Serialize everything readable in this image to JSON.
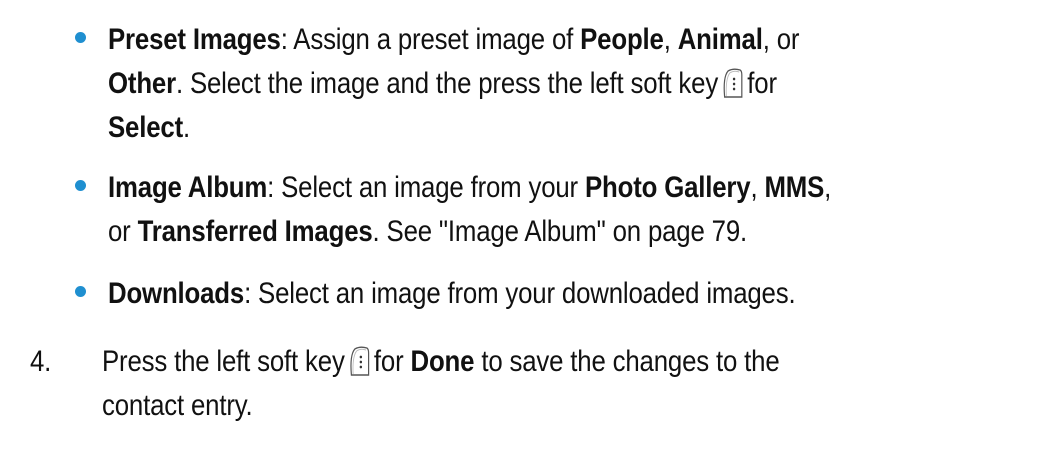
{
  "bullets": [
    {
      "line1": {
        "term": "Preset Images",
        "t1": ": Assign a preset image of ",
        "b1": "People",
        "t2": ", ",
        "b2": "Animal",
        "t3": ", or"
      },
      "line2": {
        "b1": "Other",
        "t1": ". Select the image and the press the left soft key",
        "t2": "for"
      },
      "line3": {
        "b1": "Select",
        "t1": "."
      }
    },
    {
      "line1": {
        "term": "Image Album",
        "t1": ": Select an image from your ",
        "b1": "Photo Gallery",
        "t2": ", ",
        "b2": "MMS",
        "t3": ","
      },
      "line2": {
        "t1": "or ",
        "b1": "Transferred Images",
        "t2": ". See \"Image Album\" on page 79."
      }
    },
    {
      "line1": {
        "term": "Downloads",
        "t1": ": Select an image from your downloaded images."
      }
    }
  ],
  "step": {
    "number": "4.",
    "line1": {
      "t1": "Press the left soft key",
      "t2": "for ",
      "b1": "Done",
      "t3": " to save the changes to the"
    },
    "line2": {
      "t1": "contact entry."
    }
  },
  "icons": {
    "softkey": "left-soft-key-icon",
    "bullet_color": "#1f8fd0"
  }
}
